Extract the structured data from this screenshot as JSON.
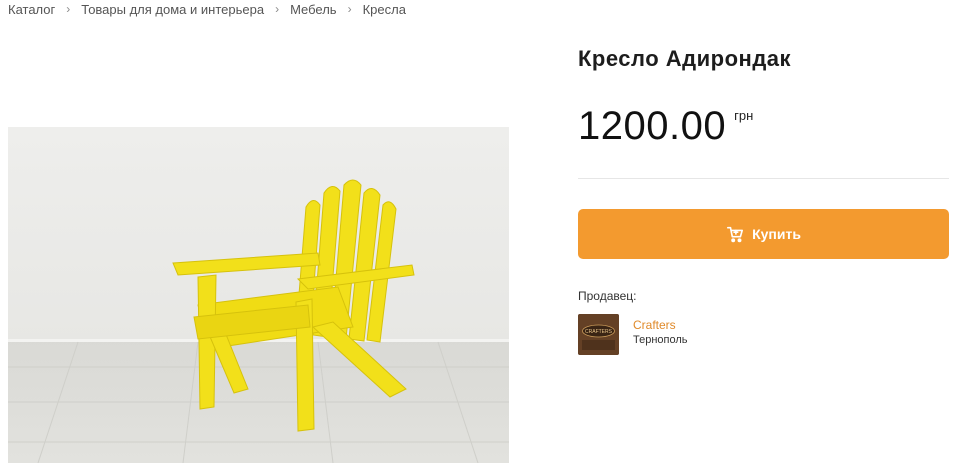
{
  "breadcrumb": {
    "items": [
      {
        "label": "Каталог"
      },
      {
        "label": "Товары для дома и интерьера"
      },
      {
        "label": "Мебель"
      },
      {
        "label": "Кресла"
      }
    ],
    "separator": "›"
  },
  "product": {
    "title": "Кресло Адирондак",
    "price": "1200.00",
    "currency": "грн",
    "image_icon": "yellow-adirondack-chair-photo",
    "accent_color": "#f39a2f"
  },
  "buy_button": {
    "label": "Купить",
    "icon": "cart-icon"
  },
  "seller": {
    "label": "Продавец:",
    "name": "Crafters",
    "city": "Тернополь",
    "logo_text": "CRAFTERS"
  }
}
